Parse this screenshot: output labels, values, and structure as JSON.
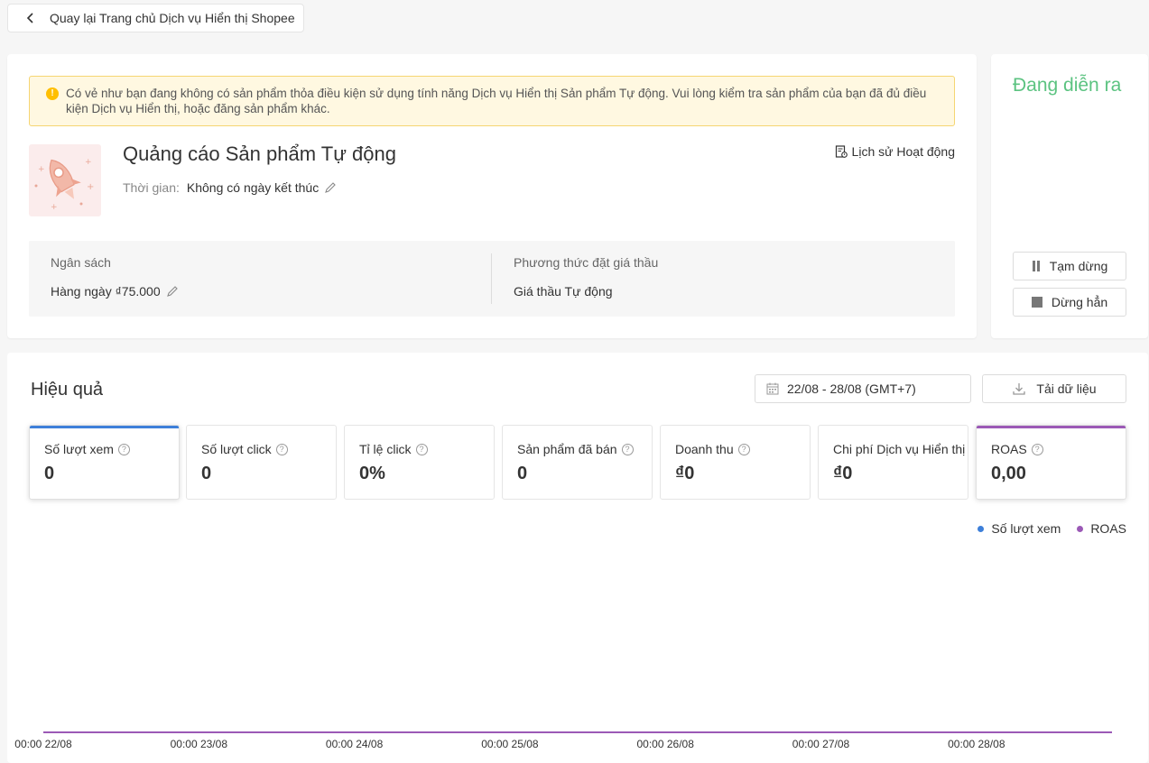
{
  "back": {
    "label": "Quay lại Trang chủ Dịch vụ Hiển thị Shopee"
  },
  "alert": {
    "text": "Có vẻ như bạn đang không có sản phẩm thỏa điều kiện sử dụng tính năng Dịch vụ Hiển thị Sản phẩm Tự động. Vui lòng kiểm tra sản phẩm của bạn đã đủ điều kiện Dịch vụ Hiển thị, hoặc đăng sản phẩm khác."
  },
  "campaign": {
    "title": "Quảng cáo Sản phẩm Tự động",
    "time_label": "Thời gian:",
    "time_value": "Không có ngày kết thúc",
    "history_label": "Lịch sử Hoạt động"
  },
  "budget": {
    "label": "Ngân sách",
    "value": "Hàng ngày ₫75.000",
    "bid_label": "Phương thức đặt giá thầu",
    "bid_value": "Giá thầu Tự động"
  },
  "side": {
    "status": "Đang diễn ra",
    "pause_label": "Tạm dừng",
    "stop_label": "Dừng hẳn"
  },
  "performance": {
    "title": "Hiệu quả",
    "date_range": "22/08 - 28/08 (GMT+7)",
    "download_label": "Tải dữ liệu",
    "metrics": [
      {
        "label": "Số lượt xem",
        "value": "0",
        "selected": true,
        "color": "#3d7fd9"
      },
      {
        "label": "Số lượt click",
        "value": "0",
        "selected": false
      },
      {
        "label": "Tỉ lệ click",
        "value": "0%",
        "selected": false
      },
      {
        "label": "Sản phẩm đã bán",
        "value": "0",
        "selected": false
      },
      {
        "label": "Doanh thu",
        "value": "₫0",
        "selected": false
      },
      {
        "label": "Chi phí Dịch vụ Hiển thị",
        "value": "₫0",
        "selected": false
      },
      {
        "label": "ROAS",
        "value": "0,00",
        "selected": true,
        "color": "#9b59b6"
      }
    ],
    "legend": [
      {
        "name": "Số lượt xem",
        "color": "#3d7fd9"
      },
      {
        "name": "ROAS",
        "color": "#9b59b6"
      }
    ]
  },
  "chart_data": {
    "type": "line",
    "categories": [
      "00:00 22/08",
      "00:00 23/08",
      "00:00 24/08",
      "00:00 25/08",
      "00:00 26/08",
      "00:00 27/08",
      "00:00 28/08"
    ],
    "series": [
      {
        "name": "Số lượt xem",
        "values": [
          0,
          0,
          0,
          0,
          0,
          0,
          0
        ]
      },
      {
        "name": "ROAS",
        "values": [
          0,
          0,
          0,
          0,
          0,
          0,
          0
        ]
      }
    ]
  }
}
